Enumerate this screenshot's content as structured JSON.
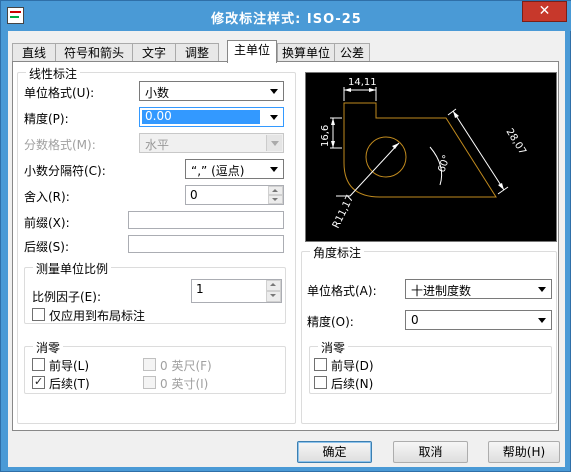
{
  "window": {
    "title": "修改标注样式: ISO-25",
    "close_glyph": "✕"
  },
  "tabs": [
    {
      "label": "直线"
    },
    {
      "label": "符号和箭头"
    },
    {
      "label": "文字"
    },
    {
      "label": "调整"
    },
    {
      "label": "主单位"
    },
    {
      "label": "换算单位"
    },
    {
      "label": "公差"
    }
  ],
  "active_tab": "主单位",
  "linear": {
    "group_title": "线性标注",
    "unit_format_label": "单位格式(U):",
    "unit_format_value": "小数",
    "precision_label": "精度(P):",
    "precision_value": "0.00",
    "fraction_format_label": "分数格式(M):",
    "fraction_format_value": "水平",
    "decimal_separator_label": "小数分隔符(C):",
    "decimal_separator_value": "“,” (逗点)",
    "round_off_label": "舍入(R):",
    "round_off_value": "0",
    "prefix_label": "前缀(X):",
    "prefix_value": "",
    "suffix_label": "后缀(S):",
    "suffix_value": ""
  },
  "scale": {
    "group_title": "测量单位比例",
    "factor_label": "比例因子(E):",
    "factor_value": "1",
    "layout_only_label": "仅应用到布局标注",
    "layout_only_checked": false
  },
  "zero_linear": {
    "group_title": "消零",
    "leading_label": "前导(L)",
    "leading_checked": false,
    "trailing_label": "后续(T)",
    "trailing_checked": true,
    "feet_label": "0 英尺(F)",
    "inches_label": "0 英寸(I)"
  },
  "preview": {
    "dim_top": "14,11",
    "dim_left": "16,6",
    "dim_right": "28,07",
    "dim_angle": "60°",
    "dim_radius": "R11,17"
  },
  "angular": {
    "group_title": "角度标注",
    "unit_format_label": "单位格式(A):",
    "unit_format_value": "十进制度数",
    "precision_label": "精度(O):",
    "precision_value": "0"
  },
  "zero_angular": {
    "group_title": "消零",
    "leading_label": "前导(D)",
    "leading_checked": false,
    "trailing_label": "后续(N)",
    "trailing_checked": false
  },
  "buttons": {
    "ok": "确定",
    "cancel": "取消",
    "help": "帮助(H)"
  },
  "colors": {
    "titlebar": "#4a9ad6",
    "close_button": "#c7382b",
    "preview_bg": "#000000",
    "preview_geometry": "#c08a1e",
    "preview_dims": "#ffffff"
  }
}
